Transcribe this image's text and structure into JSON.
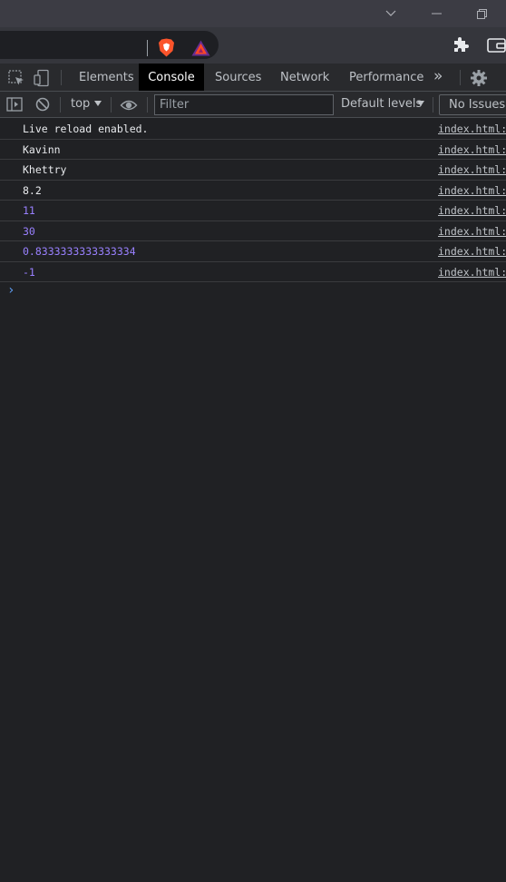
{
  "window": {
    "chevron": "⌵",
    "minimize": "—",
    "restore": "❐"
  },
  "toolbar": {
    "icons": [
      "brave-shields-icon",
      "brave-rewards-icon",
      "extensions-icon",
      "wallet-icon"
    ]
  },
  "devtools": {
    "tabs": [
      {
        "label": "Elements",
        "active": false
      },
      {
        "label": "Console",
        "active": true
      },
      {
        "label": "Sources",
        "active": false
      },
      {
        "label": "Network",
        "active": false
      },
      {
        "label": "Performance",
        "active": false
      }
    ],
    "more_tabs": "»",
    "icons": [
      "inspect-element-icon",
      "device-toolbar-icon",
      "settings-icon"
    ]
  },
  "console": {
    "context": "top",
    "filter_placeholder": "Filter",
    "levels": "Default levels",
    "issues": "No Issues",
    "messages": [
      {
        "text": "Live reload enabled.",
        "source": "index.html:",
        "type": "string"
      },
      {
        "text": "Kavinn",
        "source": "index.html:",
        "type": "string"
      },
      {
        "text": "Khettry",
        "source": "index.html:",
        "type": "string"
      },
      {
        "text": "8.2",
        "source": "index.html:",
        "type": "string"
      },
      {
        "text": "11",
        "source": "index.html:",
        "type": "number"
      },
      {
        "text": "30",
        "source": "index.html:",
        "type": "number"
      },
      {
        "text": "0.8333333333333334",
        "source": "index.html:",
        "type": "number"
      },
      {
        "text": "-1",
        "source": "index.html:",
        "type": "number"
      }
    ],
    "prompt": "›"
  },
  "colors": {
    "background": "#202124",
    "number": "#9980ff",
    "prompt": "#5f9ff6",
    "brave_orange": "#fb542b"
  }
}
